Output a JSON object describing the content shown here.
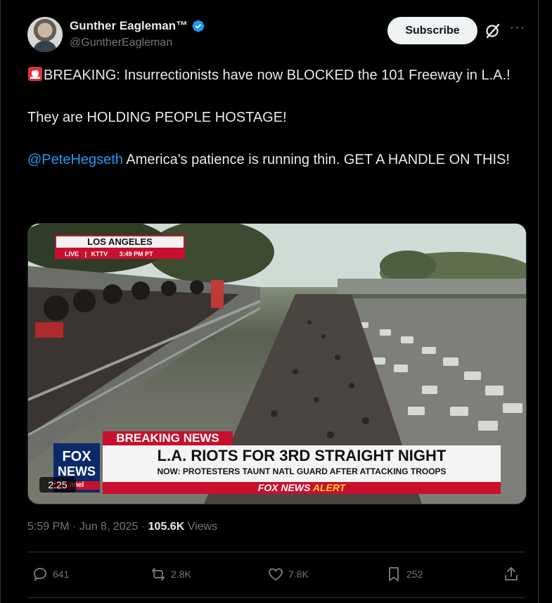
{
  "author": {
    "name": "Gunther Eagleman™",
    "handle": "@GuntherEagleman",
    "verified": true
  },
  "header": {
    "subscribe_label": "Subscribe",
    "grok_icon": "grok-slash-icon",
    "more_icon": "ellipsis-icon"
  },
  "tweet": {
    "line1": "BREAKING: Insurrectionists have now BLOCKED the 101 Freeway in L.A.!",
    "line2": "They are HOLDING PEOPLE HOSTAGE!",
    "mention": "@PeteHegseth",
    "line3": " America's patience is running thin. GET A HANDLE ON THIS!",
    "siren_icon": "rotating-light-emoji"
  },
  "video": {
    "duration": "2:25",
    "bug_location": "LOS ANGELES",
    "bug_live": "LIVE",
    "bug_station": "KTTV",
    "bug_time": "3:49 PM PT",
    "lower_third_tag": "BREAKING NEWS",
    "headline": "L.A. RIOTS FOR 3RD STRAIGHT NIGHT",
    "subheadline": "NOW: PROTESTERS TAUNT NATL GUARD AFTER ATTACKING TROOPS",
    "alert_brand": "FOX NEWS",
    "alert_word": "ALERT",
    "logo_top": "FOX",
    "logo_bottom": "NEWS",
    "logo_channel": "nnel"
  },
  "meta": {
    "time": "5:59 PM",
    "separator1": " · ",
    "date": "Jun 8, 2025",
    "separator2": " · ",
    "views_count": "105.6K",
    "views_label": " Views"
  },
  "actions": {
    "replies": "641",
    "reposts": "2.8K",
    "likes": "7.8K",
    "bookmarks": "252"
  },
  "colors": {
    "background": "#000000",
    "text": "#e7e9ea",
    "muted": "#71767b",
    "link": "#1d9bf0",
    "verified": "#1d9bf0",
    "fox_red": "#c8102e"
  }
}
